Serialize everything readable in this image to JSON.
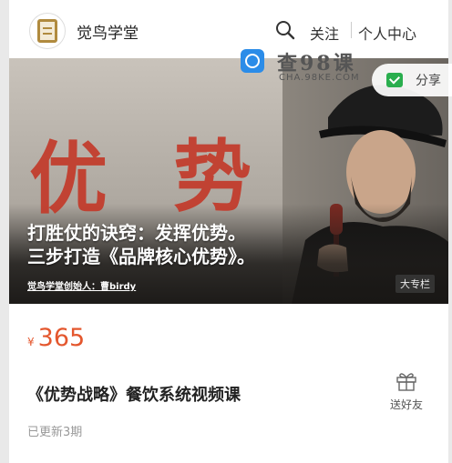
{
  "header": {
    "brand": "觉鸟学堂",
    "follow_label": "关注",
    "profile_label": "个人中心",
    "logo_icon": "book-logo-icon",
    "search_icon": "search-icon"
  },
  "banner": {
    "big_chars": [
      "优",
      "势"
    ],
    "headline_line1": "打胜仗的诀窍：发挥优势。",
    "headline_line2": "三步打造《品牌核心优势》。",
    "presenter": "觉鸟学堂创始人：曹birdy",
    "column_tag": "大专栏"
  },
  "watermark": {
    "title": "查98课",
    "subtitle": "CHA.98KE.COM"
  },
  "share": {
    "label": "分享",
    "icon": "wechat-share-icon",
    "color": "#2aae4e"
  },
  "product": {
    "currency": "¥",
    "price": "365",
    "price_color": "#e4572e",
    "title": "《优势战略》餐饮系统视频课",
    "updated": "已更新3期",
    "gift_label": "送好友",
    "gift_icon": "gift-icon"
  }
}
